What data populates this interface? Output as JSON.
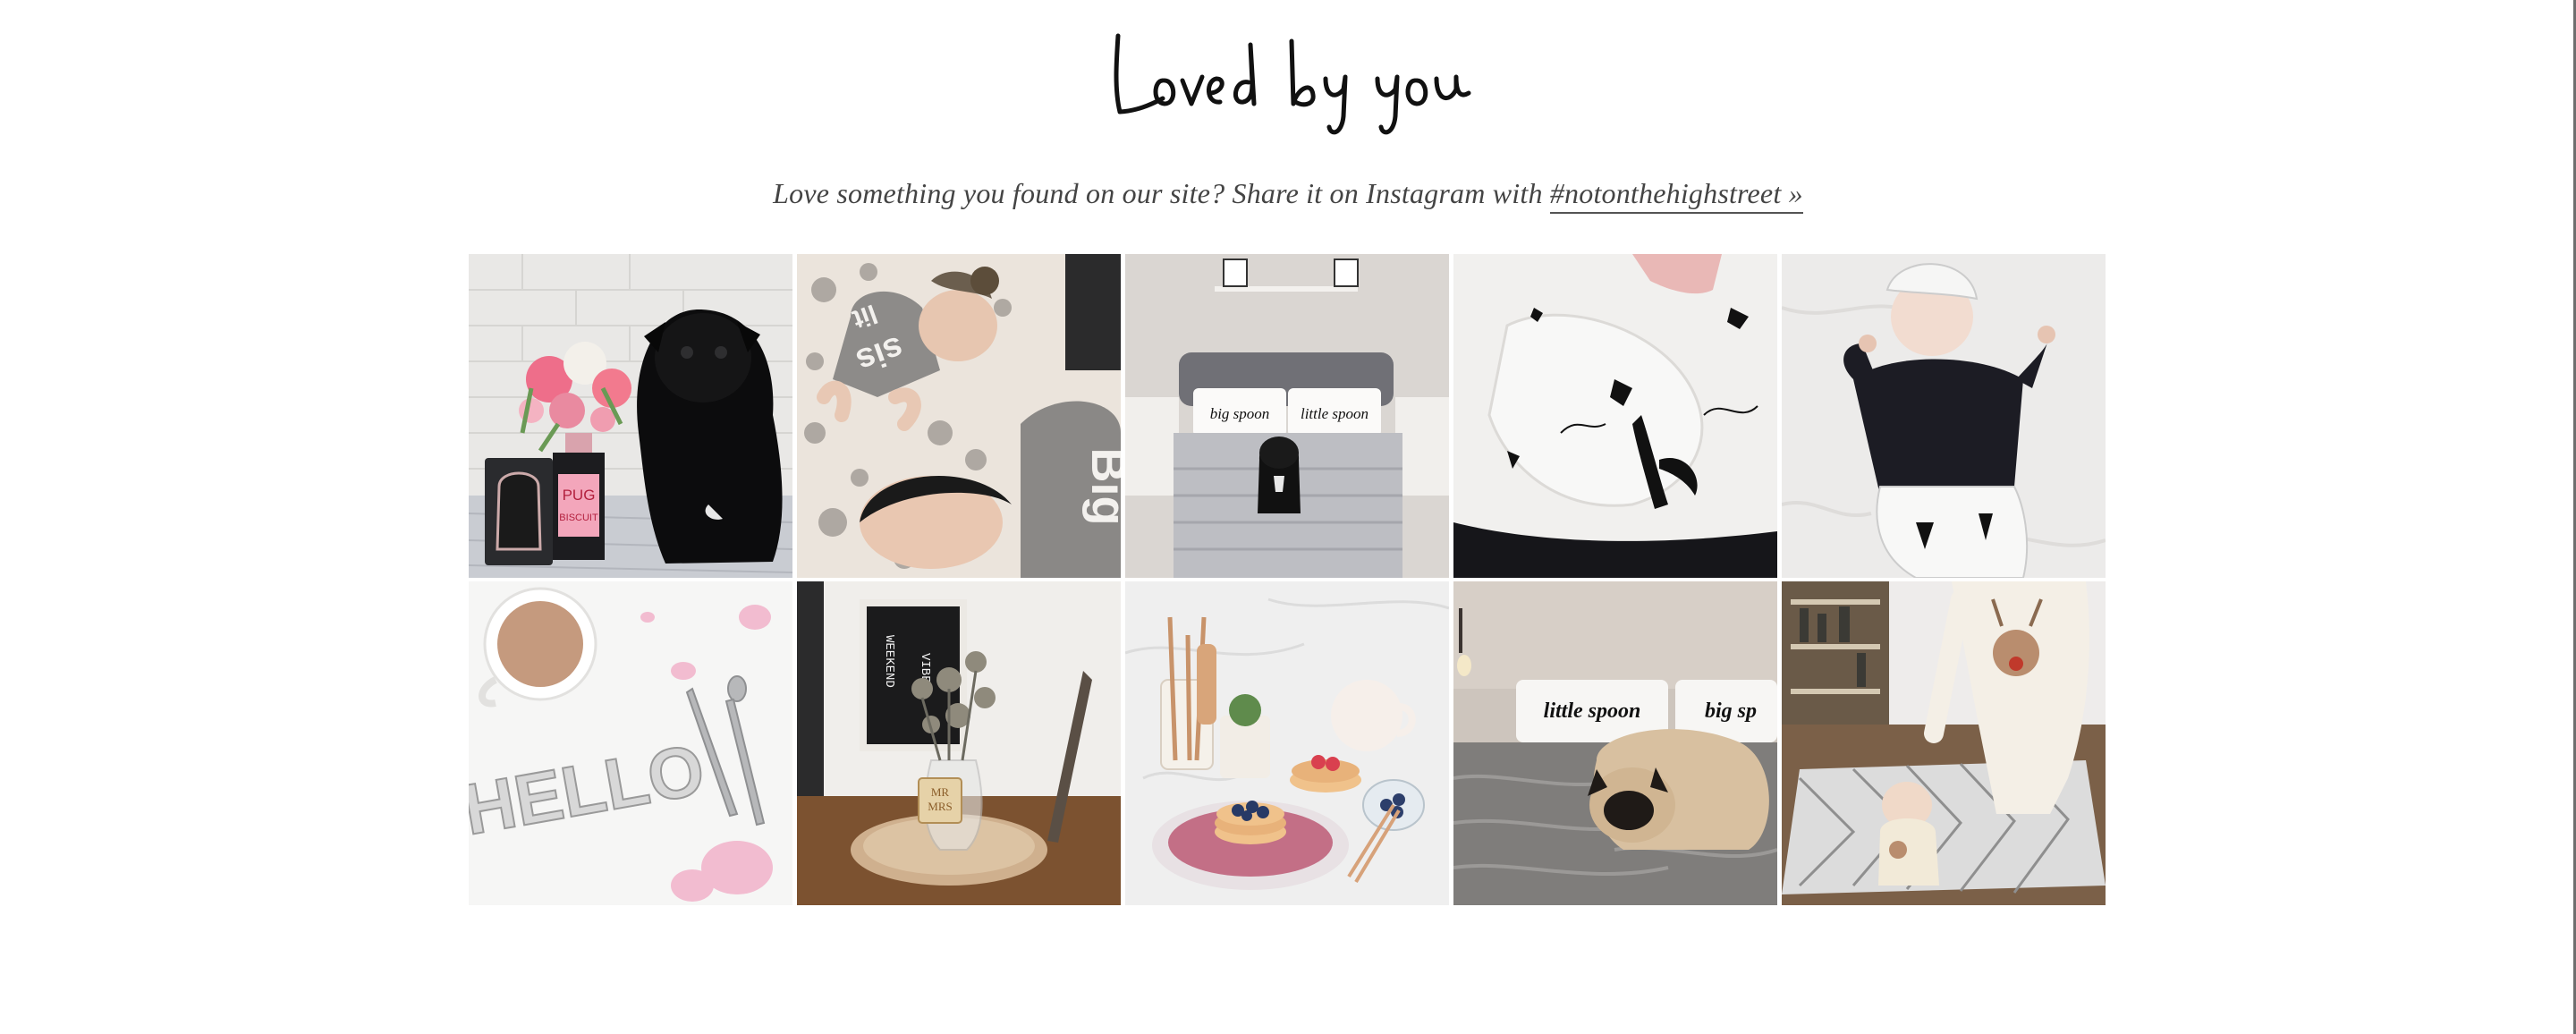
{
  "section": {
    "heading": "Loved by you",
    "subtitle": {
      "text": "Love something you found on our site? Share it on Instagram with ",
      "hashtag_link": "#notonthehighstreet »"
    }
  },
  "gallery": {
    "tiles": [
      {
        "row": 1,
        "col": 1,
        "text": [
          "PUG",
          "BISCUIT"
        ]
      },
      {
        "row": 1,
        "col": 2,
        "text": [
          "sis",
          "lit",
          "Big"
        ]
      },
      {
        "row": 1,
        "col": 3,
        "text": [
          "big spoon",
          "little spoon"
        ]
      },
      {
        "row": 1,
        "col": 4,
        "text": []
      },
      {
        "row": 1,
        "col": 5,
        "text": []
      },
      {
        "row": 2,
        "col": 1,
        "text": [
          "HELLO"
        ]
      },
      {
        "row": 2,
        "col": 2,
        "text": [
          "WEEKEND",
          "VIBES",
          "MR",
          "MRS"
        ]
      },
      {
        "row": 2,
        "col": 3,
        "text": []
      },
      {
        "row": 2,
        "col": 4,
        "text": [
          "little spoon",
          "big sp"
        ]
      },
      {
        "row": 2,
        "col": 5,
        "text": []
      }
    ]
  },
  "colors": {
    "text": "#444444",
    "heading": "#111111",
    "background": "#ffffff",
    "edge": "#6f6f6f"
  }
}
